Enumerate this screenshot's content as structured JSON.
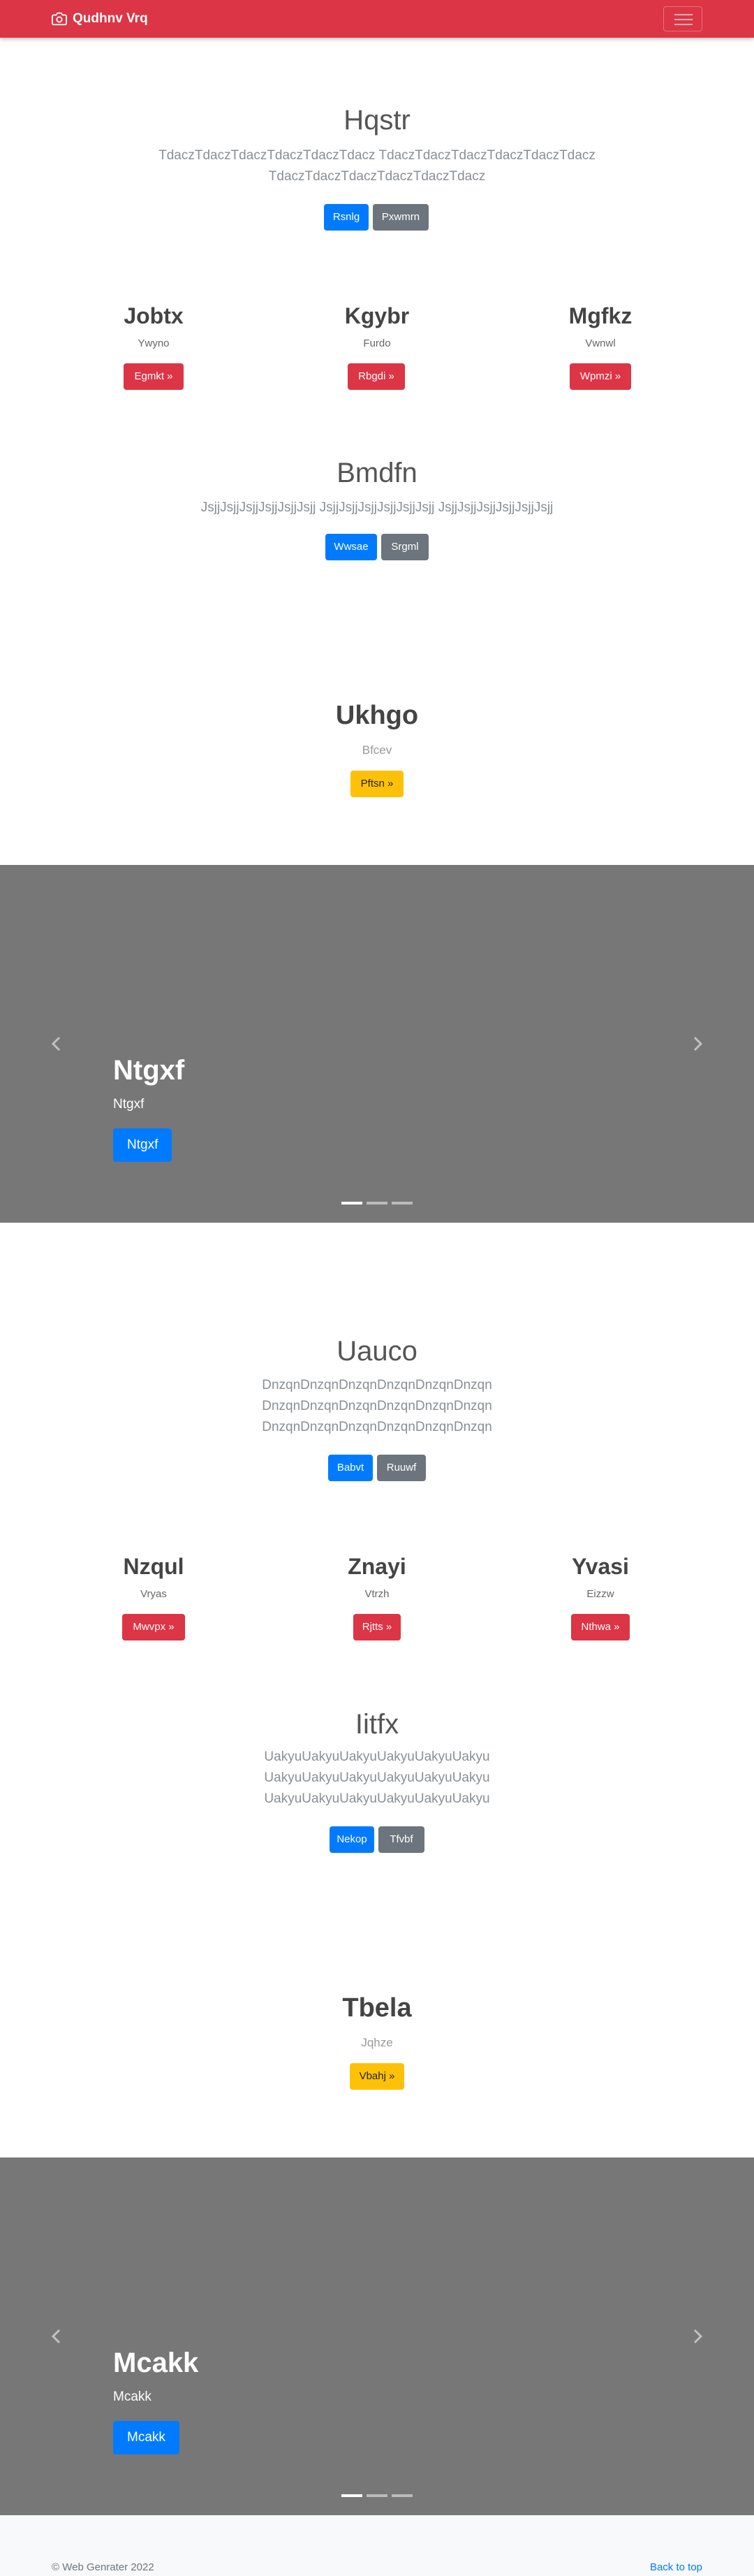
{
  "navbar": {
    "brand": "Qudhnv Vrq"
  },
  "section1": {
    "title": "Hqstr",
    "lead_line1": "TdaczTdaczTdaczTdaczTdaczTdacz TdaczTdaczTdaczTdaczTdaczTdacz",
    "lead_line2": "TdaczTdaczTdaczTdaczTdaczTdacz",
    "primary_btn": "Rsnlg",
    "secondary_btn": "Pxwmrn"
  },
  "columns1": [
    {
      "title": "Jobtx",
      "sub": "Ywyno",
      "btn": "Egmkt »"
    },
    {
      "title": "Kgybr",
      "sub": "Furdo",
      "btn": "Rbgdi »"
    },
    {
      "title": "Mgfkz",
      "sub": "Vwnwl",
      "btn": "Wpmzi »"
    }
  ],
  "section2": {
    "title": "Bmdfn",
    "lead": "JsjjJsjjJsjjJsjjJsjjJsjj JsjjJsjjJsjjJsjjJsjjJsjj JsjjJsjjJsjjJsjjJsjjJsjj",
    "primary_btn": "Wwsae",
    "secondary_btn": "Srgml"
  },
  "section3": {
    "title": "Ukhgo",
    "sub": "Bfcev",
    "btn": "Pftsn »"
  },
  "carousel1": {
    "title": "Ntgxf",
    "sub": "Ntgxf",
    "btn": "Ntgxf"
  },
  "section4": {
    "title": "Uauco",
    "lead_line1": "DnzqnDnzqnDnzqnDnzqnDnzqnDnzqn",
    "lead_line2": "DnzqnDnzqnDnzqnDnzqnDnzqnDnzqn",
    "lead_line3": "DnzqnDnzqnDnzqnDnzqnDnzqnDnzqn",
    "primary_btn": "Babvt",
    "secondary_btn": "Ruuwf"
  },
  "columns2": [
    {
      "title": "Nzqul",
      "sub": "Vryas",
      "btn": "Mwvpx »"
    },
    {
      "title": "Znayi",
      "sub": "Vtrzh",
      "btn": "Rjtts »"
    },
    {
      "title": "Yvasi",
      "sub": "Eizzw",
      "btn": "Nthwa »"
    }
  ],
  "section5": {
    "title": "Iitfx",
    "lead_line1": "UakyuUakyuUakyuUakyuUakyuUakyu",
    "lead_line2": "UakyuUakyuUakyuUakyuUakyuUakyu",
    "lead_line3": "UakyuUakyuUakyuUakyuUakyuUakyu",
    "primary_btn": "Nekop",
    "secondary_btn": "Tfvbf"
  },
  "section6": {
    "title": "Tbela",
    "sub": "Jqhze",
    "btn": "Vbahj »"
  },
  "carousel2": {
    "title": "Mcakk",
    "sub": "Mcakk",
    "btn": "Mcakk"
  },
  "footer": {
    "copyright": "© Web Genrater 2022",
    "back_to_top": "Back to top"
  },
  "colors": {
    "navbar": "#dc3545",
    "primary": "#007bff",
    "secondary": "#6c757d",
    "warning": "#ffc107",
    "carousel_bg": "#777777"
  }
}
